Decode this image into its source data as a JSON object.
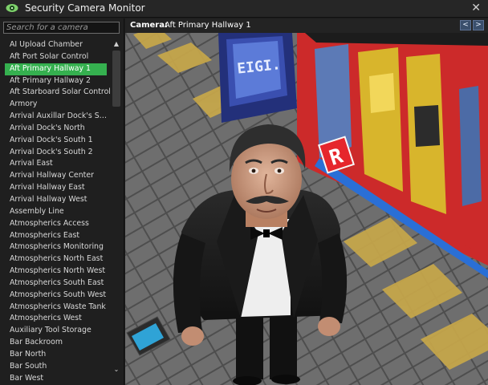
{
  "window": {
    "title": "Security Camera Monitor",
    "icon": "eye-icon",
    "close_glyph": "✕"
  },
  "search": {
    "placeholder": "Search for a camera",
    "value": ""
  },
  "camera_list": {
    "selected_index": 2,
    "items": [
      "AI Upload Chamber",
      "Aft Port Solar Control",
      "Aft Primary Hallway 1",
      "Aft Primary Hallway 2",
      "Aft Starboard Solar Control",
      "Armory",
      "Arrival Auxillar Dock's So...",
      "Arrival Dock's North",
      "Arrival Dock's South 1",
      "Arrival Dock's South 2",
      "Arrival East",
      "Arrival Hallway Center",
      "Arrival Hallway East",
      "Arrival Hallway West",
      "Assembly Line",
      "Atmospherics Access",
      "Atmospherics East",
      "Atmospherics Monitoring",
      "Atmospherics North East",
      "Atmospherics North West",
      "Atmospherics South East",
      "Atmospherics South West",
      "Atmospherics Waste Tank",
      "Atmospherics West",
      "Auxiliary Tool Storage",
      "Bar Backroom",
      "Bar North",
      "Bar South",
      "Bar West"
    ],
    "scroll_up_glyph": "▲",
    "scroll_down_glyph": "⌄"
  },
  "viewer": {
    "label": "Camera:",
    "camera_name": "Aft Primary Hallway 1",
    "prev_glyph": "<",
    "next_glyph": ">",
    "sign_letter": "R",
    "screen_text": "EIGI."
  },
  "colors": {
    "selected": "#35b04f",
    "nav_button": "#3a4f6c",
    "floor": "#6b6b6b",
    "hazard": "#c8a84a",
    "wall_red": "#d42d2d",
    "wall_yellow": "#d8b52c",
    "monitor_blue": "#3a4fb0"
  }
}
